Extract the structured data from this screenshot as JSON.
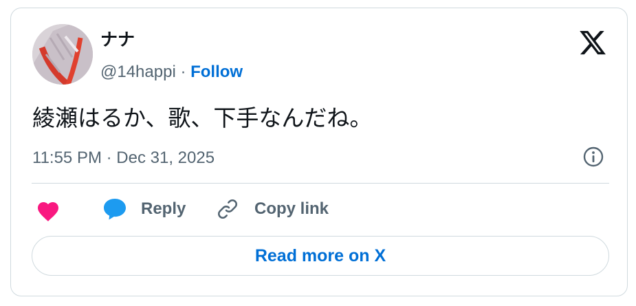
{
  "tweet": {
    "author": {
      "display_name": "ナナ",
      "handle": "@14happi",
      "separator": " · ",
      "follow_label": "Follow",
      "avatar_icon": "user-avatar-photo"
    },
    "text": "綾瀬はるか、歌、下手なんだね。",
    "timestamp": "11:55 PM · Dec 31, 2025",
    "brand_icon": "x-logo-icon",
    "info_icon": "info-icon"
  },
  "actions": {
    "like_icon": "heart-icon",
    "reply_label": "Reply",
    "reply_icon": "speech-bubble-icon",
    "copy_label": "Copy link",
    "copy_icon": "link-icon"
  },
  "read_more_label": "Read more on X",
  "colors": {
    "text_primary": "#0f1419",
    "text_secondary": "#536471",
    "link": "#006fd6",
    "like": "#f91880",
    "reply": "#1d9bf0",
    "border": "#cfd9de"
  }
}
